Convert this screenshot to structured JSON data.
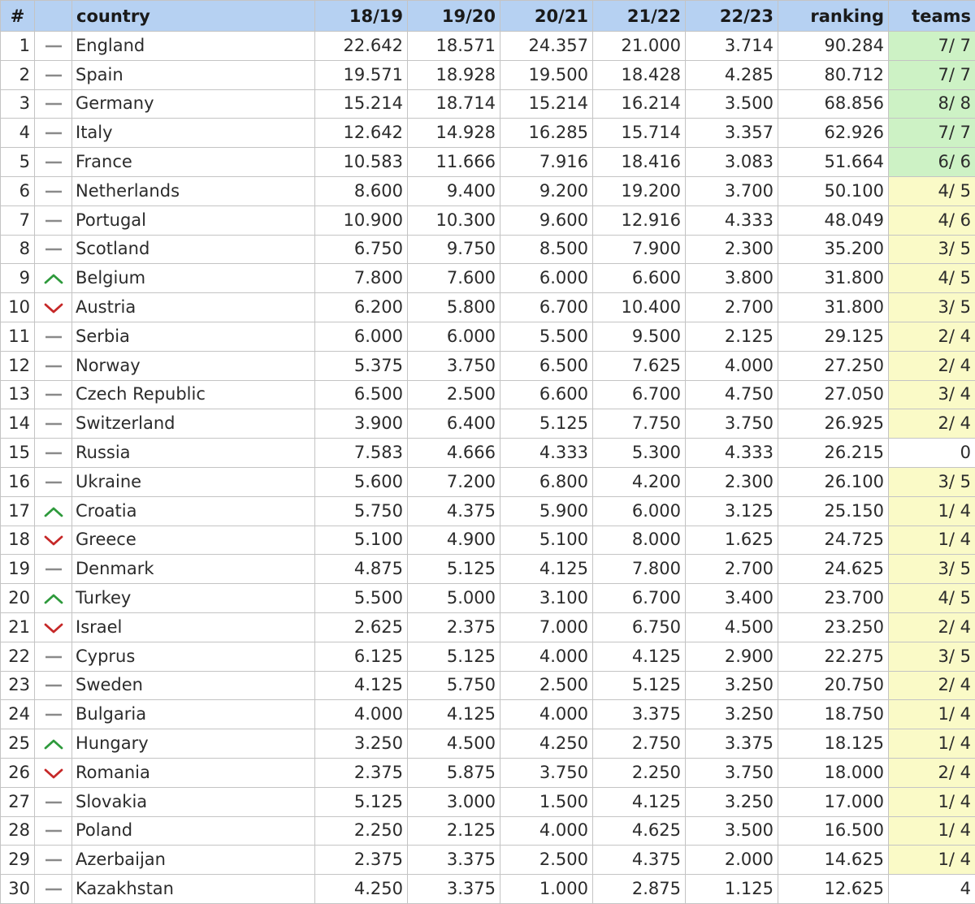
{
  "table": {
    "headers": {
      "rank": "#",
      "trend": "",
      "country": "country",
      "s1819": "18/19",
      "s1920": "19/20",
      "s2021": "20/21",
      "s2122": "21/22",
      "s2223": "22/23",
      "ranking": "ranking",
      "teams": "teams"
    },
    "colors": {
      "header_bg": "#b6d1f2",
      "teams_full_bg": "#cdf2c5",
      "teams_partial_bg": "#fafac7",
      "trend_up": "#2e9a3c",
      "trend_down": "#c62828",
      "trend_same": "#8a8a8a"
    },
    "rows": [
      {
        "rank": "1",
        "trend": "same",
        "country": "England",
        "s1819": "22.642",
        "s1920": "18.571",
        "s2021": "24.357",
        "s2122": "21.000",
        "s2223": "3.714",
        "ranking": "90.284",
        "teams": "7/ 7",
        "teams_status": "full"
      },
      {
        "rank": "2",
        "trend": "same",
        "country": "Spain",
        "s1819": "19.571",
        "s1920": "18.928",
        "s2021": "19.500",
        "s2122": "18.428",
        "s2223": "4.285",
        "ranking": "80.712",
        "teams": "7/ 7",
        "teams_status": "full"
      },
      {
        "rank": "3",
        "trend": "same",
        "country": "Germany",
        "s1819": "15.214",
        "s1920": "18.714",
        "s2021": "15.214",
        "s2122": "16.214",
        "s2223": "3.500",
        "ranking": "68.856",
        "teams": "8/ 8",
        "teams_status": "full"
      },
      {
        "rank": "4",
        "trend": "same",
        "country": "Italy",
        "s1819": "12.642",
        "s1920": "14.928",
        "s2021": "16.285",
        "s2122": "15.714",
        "s2223": "3.357",
        "ranking": "62.926",
        "teams": "7/ 7",
        "teams_status": "full"
      },
      {
        "rank": "5",
        "trend": "same",
        "country": "France",
        "s1819": "10.583",
        "s1920": "11.666",
        "s2021": "7.916",
        "s2122": "18.416",
        "s2223": "3.083",
        "ranking": "51.664",
        "teams": "6/ 6",
        "teams_status": "full"
      },
      {
        "rank": "6",
        "trend": "same",
        "country": "Netherlands",
        "s1819": "8.600",
        "s1920": "9.400",
        "s2021": "9.200",
        "s2122": "19.200",
        "s2223": "3.700",
        "ranking": "50.100",
        "teams": "4/ 5",
        "teams_status": "partial"
      },
      {
        "rank": "7",
        "trend": "same",
        "country": "Portugal",
        "s1819": "10.900",
        "s1920": "10.300",
        "s2021": "9.600",
        "s2122": "12.916",
        "s2223": "4.333",
        "ranking": "48.049",
        "teams": "4/ 6",
        "teams_status": "partial"
      },
      {
        "rank": "8",
        "trend": "same",
        "country": "Scotland",
        "s1819": "6.750",
        "s1920": "9.750",
        "s2021": "8.500",
        "s2122": "7.900",
        "s2223": "2.300",
        "ranking": "35.200",
        "teams": "3/ 5",
        "teams_status": "partial"
      },
      {
        "rank": "9",
        "trend": "up",
        "country": "Belgium",
        "s1819": "7.800",
        "s1920": "7.600",
        "s2021": "6.000",
        "s2122": "6.600",
        "s2223": "3.800",
        "ranking": "31.800",
        "teams": "4/ 5",
        "teams_status": "partial"
      },
      {
        "rank": "10",
        "trend": "down",
        "country": "Austria",
        "s1819": "6.200",
        "s1920": "5.800",
        "s2021": "6.700",
        "s2122": "10.400",
        "s2223": "2.700",
        "ranking": "31.800",
        "teams": "3/ 5",
        "teams_status": "partial"
      },
      {
        "rank": "11",
        "trend": "same",
        "country": "Serbia",
        "s1819": "6.000",
        "s1920": "6.000",
        "s2021": "5.500",
        "s2122": "9.500",
        "s2223": "2.125",
        "ranking": "29.125",
        "teams": "2/ 4",
        "teams_status": "partial"
      },
      {
        "rank": "12",
        "trend": "same",
        "country": "Norway",
        "s1819": "5.375",
        "s1920": "3.750",
        "s2021": "6.500",
        "s2122": "7.625",
        "s2223": "4.000",
        "ranking": "27.250",
        "teams": "2/ 4",
        "teams_status": "partial"
      },
      {
        "rank": "13",
        "trend": "same",
        "country": "Czech Republic",
        "s1819": "6.500",
        "s1920": "2.500",
        "s2021": "6.600",
        "s2122": "6.700",
        "s2223": "4.750",
        "ranking": "27.050",
        "teams": "3/ 4",
        "teams_status": "partial"
      },
      {
        "rank": "14",
        "trend": "same",
        "country": "Switzerland",
        "s1819": "3.900",
        "s1920": "6.400",
        "s2021": "5.125",
        "s2122": "7.750",
        "s2223": "3.750",
        "ranking": "26.925",
        "teams": "2/ 4",
        "teams_status": "partial"
      },
      {
        "rank": "15",
        "trend": "same",
        "country": "Russia",
        "s1819": "7.583",
        "s1920": "4.666",
        "s2021": "4.333",
        "s2122": "5.300",
        "s2223": "4.333",
        "ranking": "26.215",
        "teams": "0",
        "teams_status": "none"
      },
      {
        "rank": "16",
        "trend": "same",
        "country": "Ukraine",
        "s1819": "5.600",
        "s1920": "7.200",
        "s2021": "6.800",
        "s2122": "4.200",
        "s2223": "2.300",
        "ranking": "26.100",
        "teams": "3/ 5",
        "teams_status": "partial"
      },
      {
        "rank": "17",
        "trend": "up",
        "country": "Croatia",
        "s1819": "5.750",
        "s1920": "4.375",
        "s2021": "5.900",
        "s2122": "6.000",
        "s2223": "3.125",
        "ranking": "25.150",
        "teams": "1/ 4",
        "teams_status": "partial"
      },
      {
        "rank": "18",
        "trend": "down",
        "country": "Greece",
        "s1819": "5.100",
        "s1920": "4.900",
        "s2021": "5.100",
        "s2122": "8.000",
        "s2223": "1.625",
        "ranking": "24.725",
        "teams": "1/ 4",
        "teams_status": "partial"
      },
      {
        "rank": "19",
        "trend": "same",
        "country": "Denmark",
        "s1819": "4.875",
        "s1920": "5.125",
        "s2021": "4.125",
        "s2122": "7.800",
        "s2223": "2.700",
        "ranking": "24.625",
        "teams": "3/ 5",
        "teams_status": "partial"
      },
      {
        "rank": "20",
        "trend": "up",
        "country": "Turkey",
        "s1819": "5.500",
        "s1920": "5.000",
        "s2021": "3.100",
        "s2122": "6.700",
        "s2223": "3.400",
        "ranking": "23.700",
        "teams": "4/ 5",
        "teams_status": "partial"
      },
      {
        "rank": "21",
        "trend": "down",
        "country": "Israel",
        "s1819": "2.625",
        "s1920": "2.375",
        "s2021": "7.000",
        "s2122": "6.750",
        "s2223": "4.500",
        "ranking": "23.250",
        "teams": "2/ 4",
        "teams_status": "partial"
      },
      {
        "rank": "22",
        "trend": "same",
        "country": "Cyprus",
        "s1819": "6.125",
        "s1920": "5.125",
        "s2021": "4.000",
        "s2122": "4.125",
        "s2223": "2.900",
        "ranking": "22.275",
        "teams": "3/ 5",
        "teams_status": "partial"
      },
      {
        "rank": "23",
        "trend": "same",
        "country": "Sweden",
        "s1819": "4.125",
        "s1920": "5.750",
        "s2021": "2.500",
        "s2122": "5.125",
        "s2223": "3.250",
        "ranking": "20.750",
        "teams": "2/ 4",
        "teams_status": "partial"
      },
      {
        "rank": "24",
        "trend": "same",
        "country": "Bulgaria",
        "s1819": "4.000",
        "s1920": "4.125",
        "s2021": "4.000",
        "s2122": "3.375",
        "s2223": "3.250",
        "ranking": "18.750",
        "teams": "1/ 4",
        "teams_status": "partial"
      },
      {
        "rank": "25",
        "trend": "up",
        "country": "Hungary",
        "s1819": "3.250",
        "s1920": "4.500",
        "s2021": "4.250",
        "s2122": "2.750",
        "s2223": "3.375",
        "ranking": "18.125",
        "teams": "1/ 4",
        "teams_status": "partial"
      },
      {
        "rank": "26",
        "trend": "down",
        "country": "Romania",
        "s1819": "2.375",
        "s1920": "5.875",
        "s2021": "3.750",
        "s2122": "2.250",
        "s2223": "3.750",
        "ranking": "18.000",
        "teams": "2/ 4",
        "teams_status": "partial"
      },
      {
        "rank": "27",
        "trend": "same",
        "country": "Slovakia",
        "s1819": "5.125",
        "s1920": "3.000",
        "s2021": "1.500",
        "s2122": "4.125",
        "s2223": "3.250",
        "ranking": "17.000",
        "teams": "1/ 4",
        "teams_status": "partial"
      },
      {
        "rank": "28",
        "trend": "same",
        "country": "Poland",
        "s1819": "2.250",
        "s1920": "2.125",
        "s2021": "4.000",
        "s2122": "4.625",
        "s2223": "3.500",
        "ranking": "16.500",
        "teams": "1/ 4",
        "teams_status": "partial"
      },
      {
        "rank": "29",
        "trend": "same",
        "country": "Azerbaijan",
        "s1819": "2.375",
        "s1920": "3.375",
        "s2021": "2.500",
        "s2122": "4.375",
        "s2223": "2.000",
        "ranking": "14.625",
        "teams": "1/ 4",
        "teams_status": "partial"
      },
      {
        "rank": "30",
        "trend": "same",
        "country": "Kazakhstan",
        "s1819": "4.250",
        "s1920": "3.375",
        "s2021": "1.000",
        "s2122": "2.875",
        "s2223": "1.125",
        "ranking": "12.625",
        "teams": "4",
        "teams_status": "none"
      }
    ]
  }
}
